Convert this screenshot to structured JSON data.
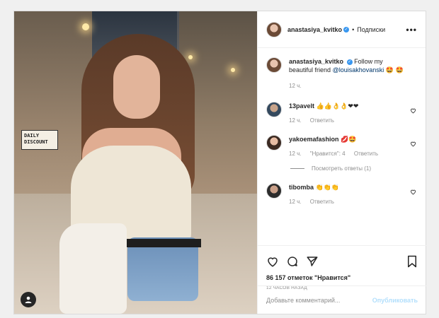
{
  "post": {
    "photo_sign": [
      "DAILY",
      "DISCOUNT"
    ],
    "header": {
      "username": "anastasiya_kvitko",
      "separator": "•",
      "follow_label": "Подписки",
      "more_label": "•••"
    },
    "caption": {
      "username": "anastasiya_kvitko",
      "text": "Follow my beautiful friend",
      "mention": "@louisakhovanski",
      "emoji": "🤩 🤩",
      "time": "12 ч."
    },
    "comments": [
      {
        "username": "13pavelt",
        "text": "👍👍👌👌❤❤",
        "time": "12 ч.",
        "reply_label": "Ответить"
      },
      {
        "username": "yakoemafashion",
        "text": "💋🤩",
        "time": "12 ч.",
        "likes_label": "\"Нравится\": 4",
        "reply_label": "Ответить",
        "view_replies": "Посмотреть ответы (1)"
      },
      {
        "username": "tibomba",
        "text": "👏👏👏",
        "time": "12 ч.",
        "reply_label": "Ответить"
      }
    ],
    "likes": "86 157 отметок \"Нравится\"",
    "timestamp": "12 ЧАСОВ НАЗАД",
    "comment_box": {
      "placeholder": "Добавьте комментарий...",
      "publish_label": "Опубликовать"
    }
  }
}
